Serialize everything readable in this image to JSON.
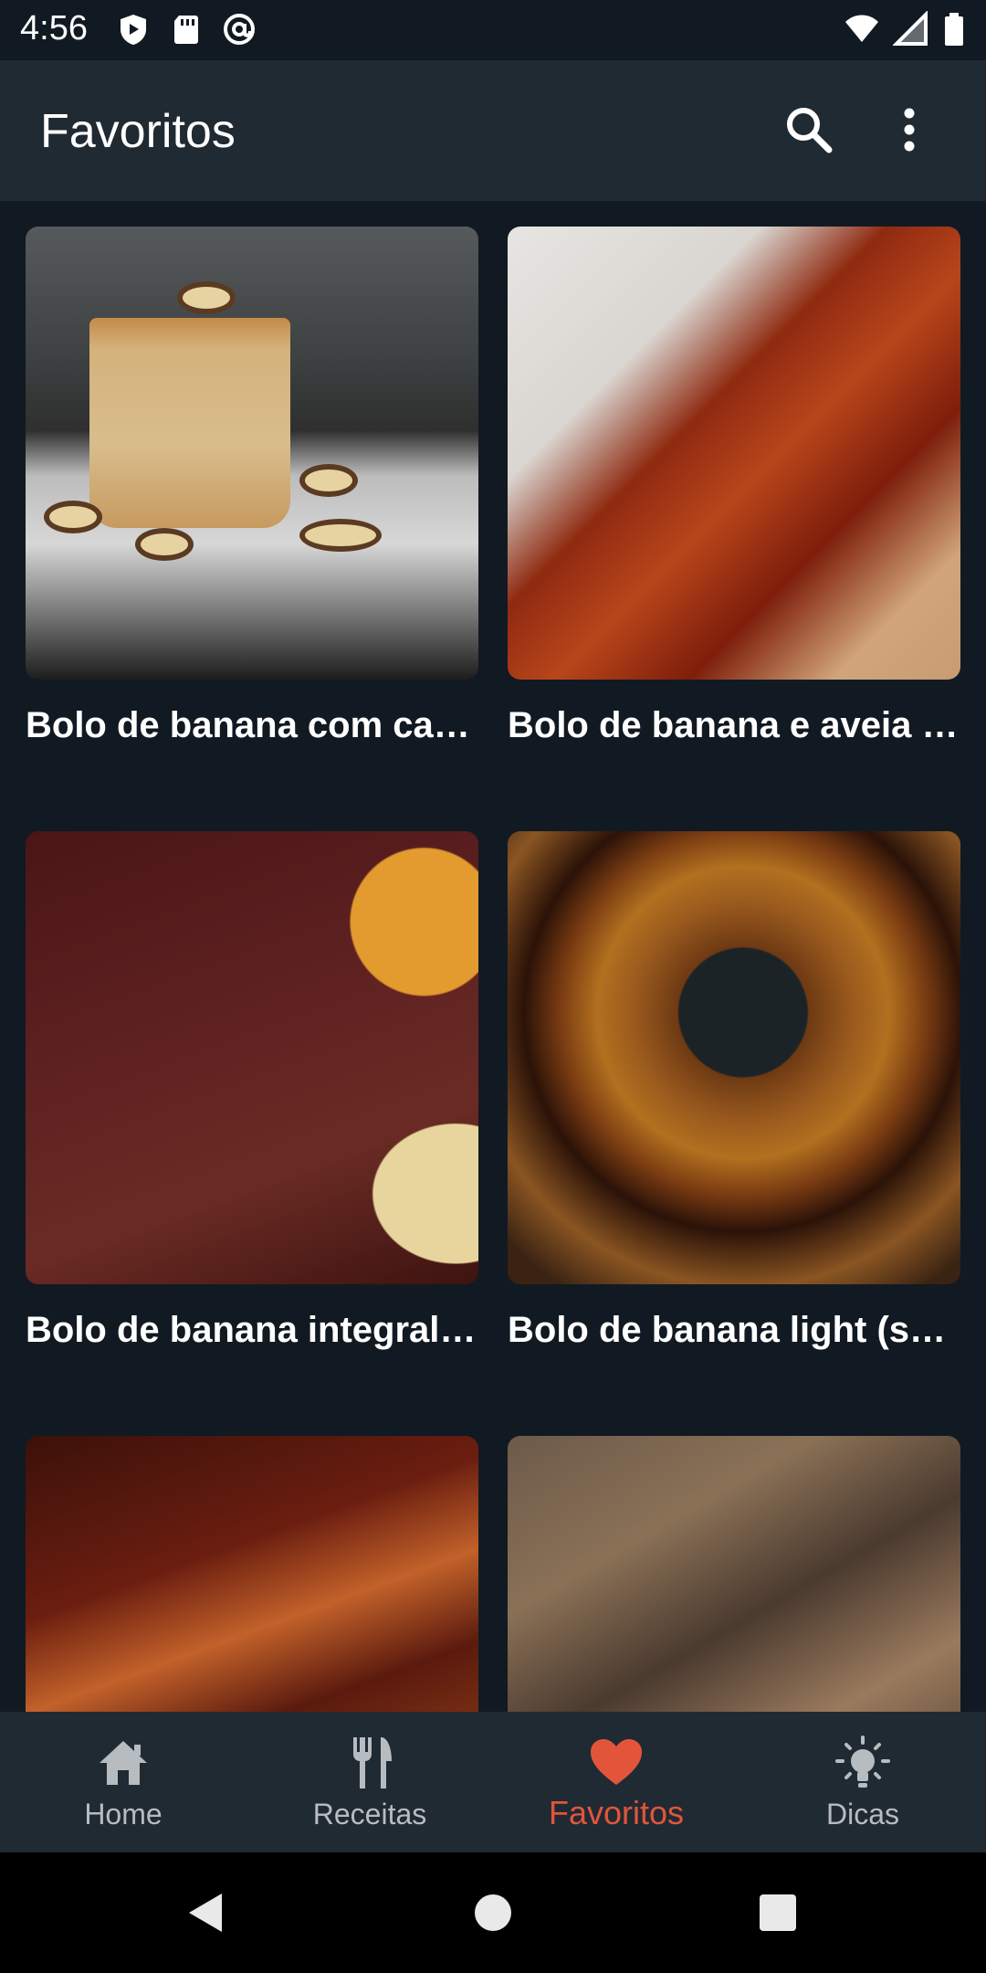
{
  "status_bar": {
    "time": "4:56",
    "left_icons": [
      "shield-icon",
      "sd-card-icon",
      "at-sign-icon"
    ],
    "right_icons": [
      "wifi-icon",
      "signal-icon",
      "battery-icon"
    ]
  },
  "app_bar": {
    "title": "Favoritos",
    "actions": [
      "search-icon",
      "more-vert-icon"
    ]
  },
  "recipes": [
    {
      "title": "Bolo de banana com can…"
    },
    {
      "title": "Bolo de banana e aveia c…"
    },
    {
      "title": "Bolo de banana integral c…"
    },
    {
      "title": "Bolo de banana light (se…"
    },
    {
      "title": ""
    },
    {
      "title": ""
    }
  ],
  "bottom_nav": {
    "items": [
      {
        "label": "Home",
        "icon": "home-icon"
      },
      {
        "label": "Receitas",
        "icon": "fork-knife-icon"
      },
      {
        "label": "Favoritos",
        "icon": "heart-icon"
      },
      {
        "label": "Dicas",
        "icon": "lightbulb-icon"
      }
    ],
    "active_index": 2
  },
  "colors": {
    "background": "#111a22",
    "app_bar": "#202a33",
    "accent": "#e2553a",
    "inactive_label": "#b7bcc0"
  }
}
